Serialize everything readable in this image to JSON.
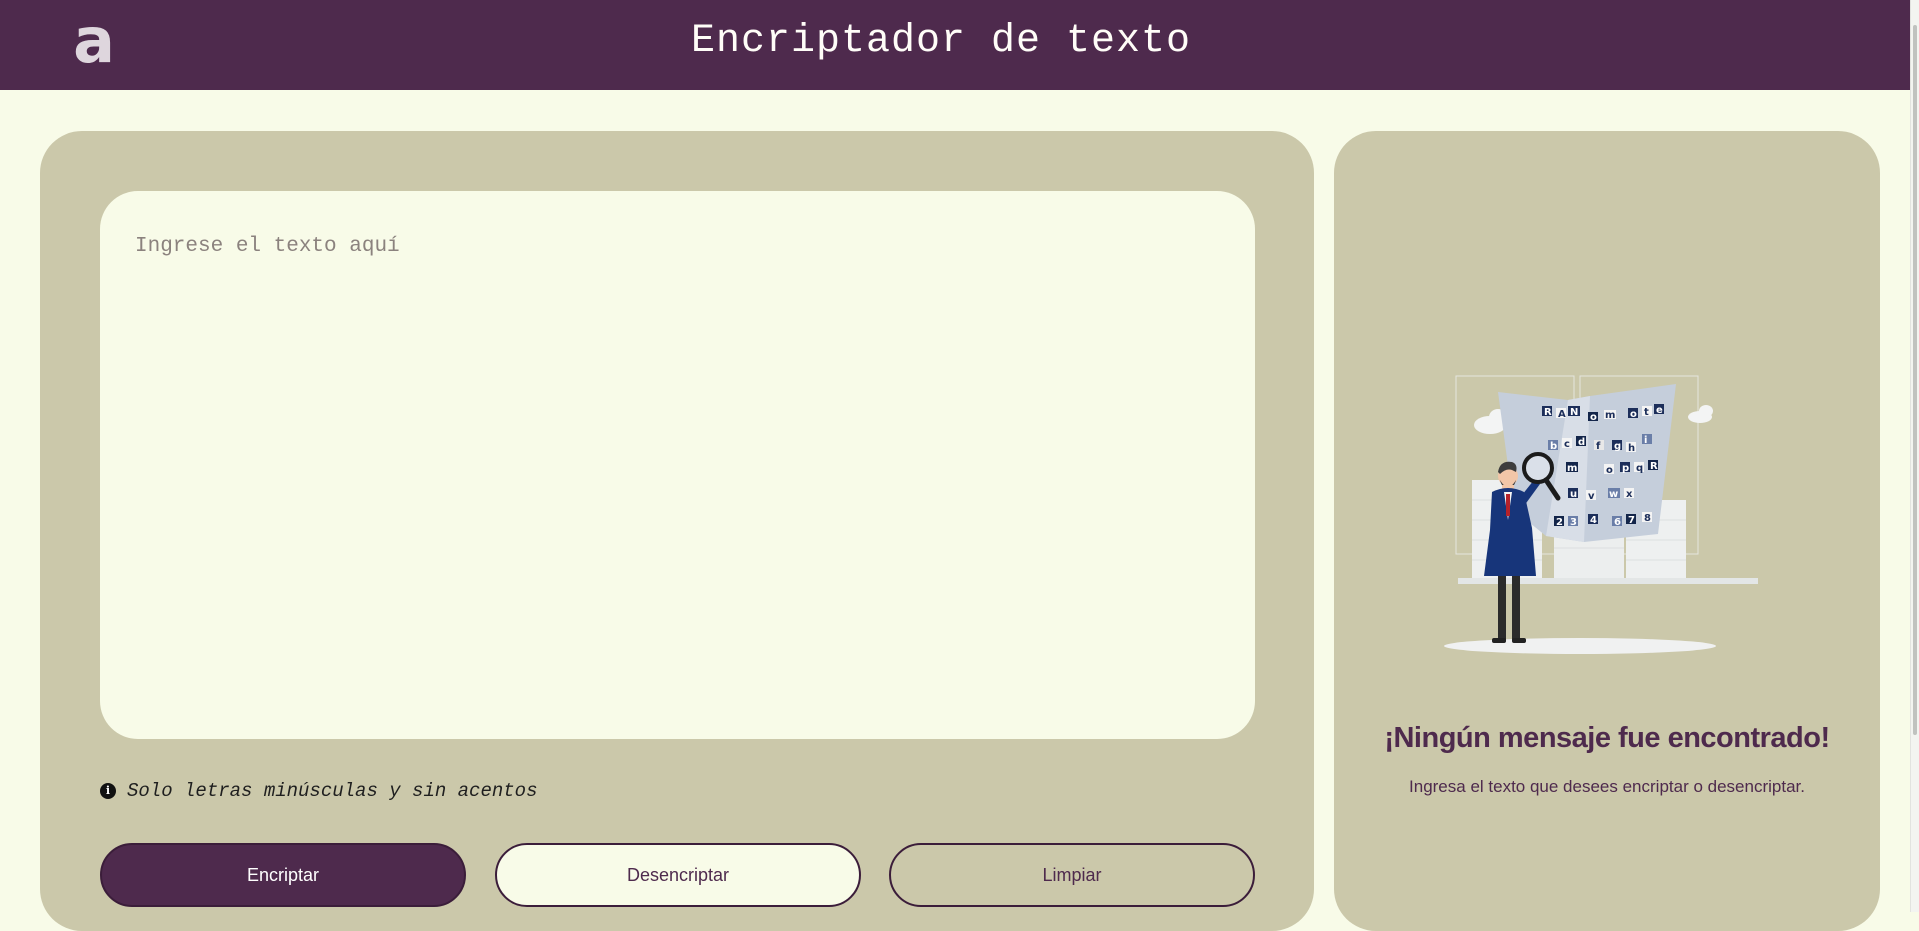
{
  "header": {
    "logo_text": "a",
    "title": "Encriptador de texto"
  },
  "input": {
    "placeholder": "Ingrese el texto aquí",
    "value": ""
  },
  "hint": {
    "icon": "info-icon",
    "text": "Solo letras minúsculas y sin acentos"
  },
  "buttons": {
    "encrypt": "Encriptar",
    "decrypt": "Desencriptar",
    "clear": "Limpiar"
  },
  "output": {
    "illustration": "detective-with-magnifier-illustration",
    "title": "¡Ningún mensaje fue encontrado!",
    "subtitle": "Ingresa el texto que desees encriptar o desencriptar."
  },
  "colors": {
    "header_bg": "#4e2a4d",
    "page_bg": "#f8fbe8",
    "panel_bg": "#cbc8aa",
    "accent": "#4e2a4d"
  }
}
